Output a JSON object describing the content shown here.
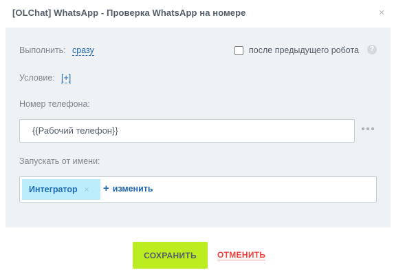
{
  "dialog": {
    "title": "[OLChat] WhatsApp - Проверка WhatsApp на номере",
    "close_glyph": "×"
  },
  "execute": {
    "label": "Выполнить:",
    "value": "сразу"
  },
  "after_previous": {
    "label": "после предыдущего робота",
    "checked": false,
    "help_glyph": "?"
  },
  "condition": {
    "label": "Условие:",
    "value": "[+]"
  },
  "phone": {
    "label": "Номер телефона:",
    "value": "{{Рабочий телефон}}"
  },
  "run_as": {
    "label": "Запускать от имени:",
    "user": "Интегратор",
    "remove_glyph": "×",
    "change_label": "изменить",
    "plus_glyph": "+"
  },
  "footer": {
    "save_label": "СОХРАНИТЬ",
    "cancel_label": "ОТМЕНИТЬ"
  },
  "colors": {
    "accent": "#2067b0",
    "save_button": "#bbed21",
    "cancel": "#f0403a",
    "panel": "#eef2f4",
    "user_tag": "#bcedfc"
  },
  "icons": {
    "close": "close-icon",
    "help": "help-icon",
    "more": "more-dots-icon",
    "remove": "remove-icon",
    "add": "plus-icon"
  }
}
